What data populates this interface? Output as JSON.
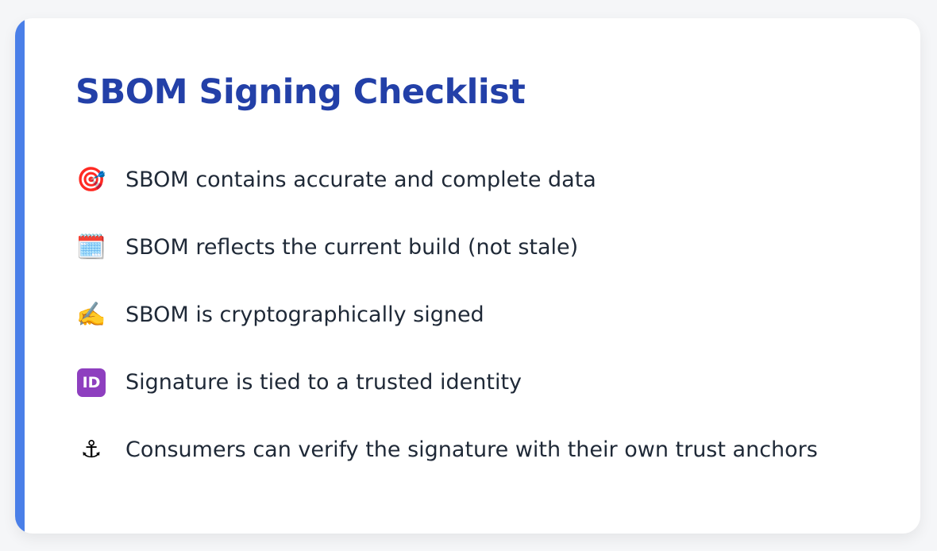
{
  "title": "SBOM Signing Checklist",
  "colors": {
    "accent": "#4a7fe8",
    "title": "#2340a8",
    "text": "#1f2937"
  },
  "items": [
    {
      "icon": "🎯",
      "icon_name": "direct-hit-target-icon",
      "text": "SBOM contains accurate and complete data"
    },
    {
      "icon": "🗓️",
      "icon_name": "spiral-calendar-icon",
      "text": "SBOM reflects the current build (not stale)"
    },
    {
      "icon": "✍️",
      "icon_name": "writing-hand-icon",
      "text": "SBOM is cryptographically signed"
    },
    {
      "icon": "ID",
      "icon_name": "id-button-icon",
      "text": "Signature is tied to a trusted identity"
    },
    {
      "icon": "⚓",
      "icon_name": "anchor-icon",
      "text": "Consumers can verify the signature with their own trust anchors"
    }
  ]
}
